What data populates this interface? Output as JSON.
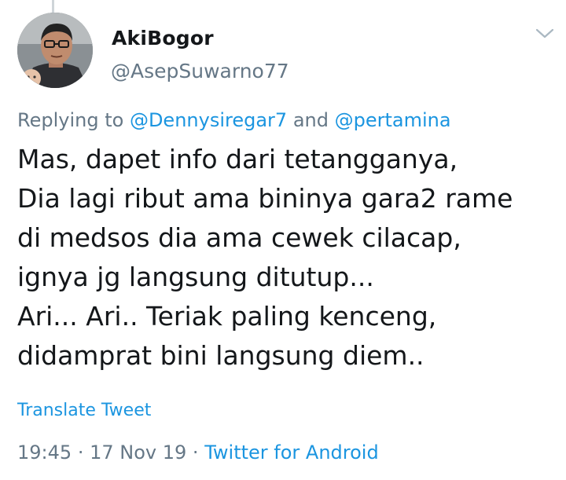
{
  "tweet": {
    "display_name": "AkiBogor",
    "handle": "@AsepSuwarno77",
    "reply_prefix": "Replying to",
    "reply_to_1": "@Dennysiregar7",
    "reply_joiner": "and",
    "reply_to_2": "@pertamina",
    "lines": [
      "Mas,  dapet info dari tetangganya,",
      "Dia lagi ribut ama bininya gara2 rame",
      "di medsos dia ama cewek cilacap,",
      "ignya jg langsung ditutup...",
      "Ari... Ari.. Teriak paling kenceng,",
      "didamprat bini langsung diem.."
    ],
    "translate_label": "Translate Tweet",
    "time": "19:45",
    "separator": "·",
    "date": "17 Nov 19",
    "source": "Twitter for Android"
  },
  "icons": {
    "avatar": "avatar-photo",
    "menu": "chevron-down-icon"
  },
  "colors": {
    "text": "#14171a",
    "secondary": "#657786",
    "link": "#1b95e0"
  }
}
